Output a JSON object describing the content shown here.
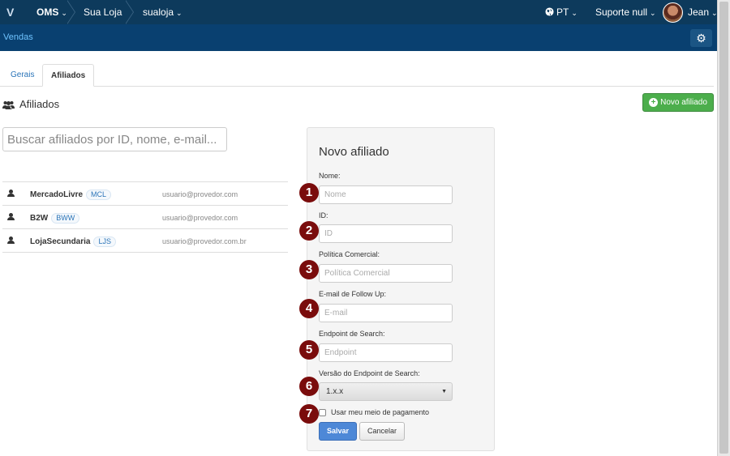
{
  "topbar": {
    "logo": "V",
    "breadcrumbs": [
      {
        "label": "OMS",
        "chevron": "⌄"
      },
      {
        "label": "Sua Loja",
        "chevron": "⌄"
      },
      {
        "label": "sualoja",
        "chevron": "⌄"
      }
    ],
    "language": "PT",
    "support": "Suporte null",
    "user": "Jean",
    "chevron": "⌄"
  },
  "subbar": {
    "title": "Vendas"
  },
  "tabs": [
    {
      "label": "Gerais",
      "active": false
    },
    {
      "label": "Afiliados",
      "active": true
    }
  ],
  "section": {
    "title": "Afiliados",
    "new_button": "Novo afiliado"
  },
  "search": {
    "placeholder": "Buscar afiliados por ID, nome, e-mail..."
  },
  "affiliates": [
    {
      "name": "MercadoLivre",
      "badge": "MCL",
      "email": "usuario@provedor.com"
    },
    {
      "name": "B2W",
      "badge": "BWW",
      "email": "usuario@provedor.com"
    },
    {
      "name": "LojaSecundaria",
      "badge": "LJS",
      "email": "usuario@provedor.com.br"
    }
  ],
  "form": {
    "title": "Novo afiliado",
    "fields": [
      {
        "step": "1",
        "label": "Nome:",
        "placeholder": "Nome"
      },
      {
        "step": "2",
        "label": "ID:",
        "placeholder": "ID"
      },
      {
        "step": "3",
        "label": "Política Comercial:",
        "placeholder": "Política Comercial"
      },
      {
        "step": "4",
        "label": "E-mail de Follow Up:",
        "placeholder": "E-mail"
      },
      {
        "step": "5",
        "label": "Endpoint de Search:",
        "placeholder": "Endpoint"
      }
    ],
    "version": {
      "step": "6",
      "label": "Versão do Endpoint de Search:",
      "value": "1.x.x"
    },
    "payment": {
      "step": "7",
      "label": "Usar meu meio de pagamento",
      "checked": false
    },
    "save": "Salvar",
    "cancel": "Cancelar"
  },
  "colors": {
    "topbar": "#0d3a5c",
    "subbar": "#094070",
    "link": "#2a74b8",
    "success": "#4cae4c",
    "primary": "#4d88d7",
    "step_marker": "#7a0c0c"
  }
}
